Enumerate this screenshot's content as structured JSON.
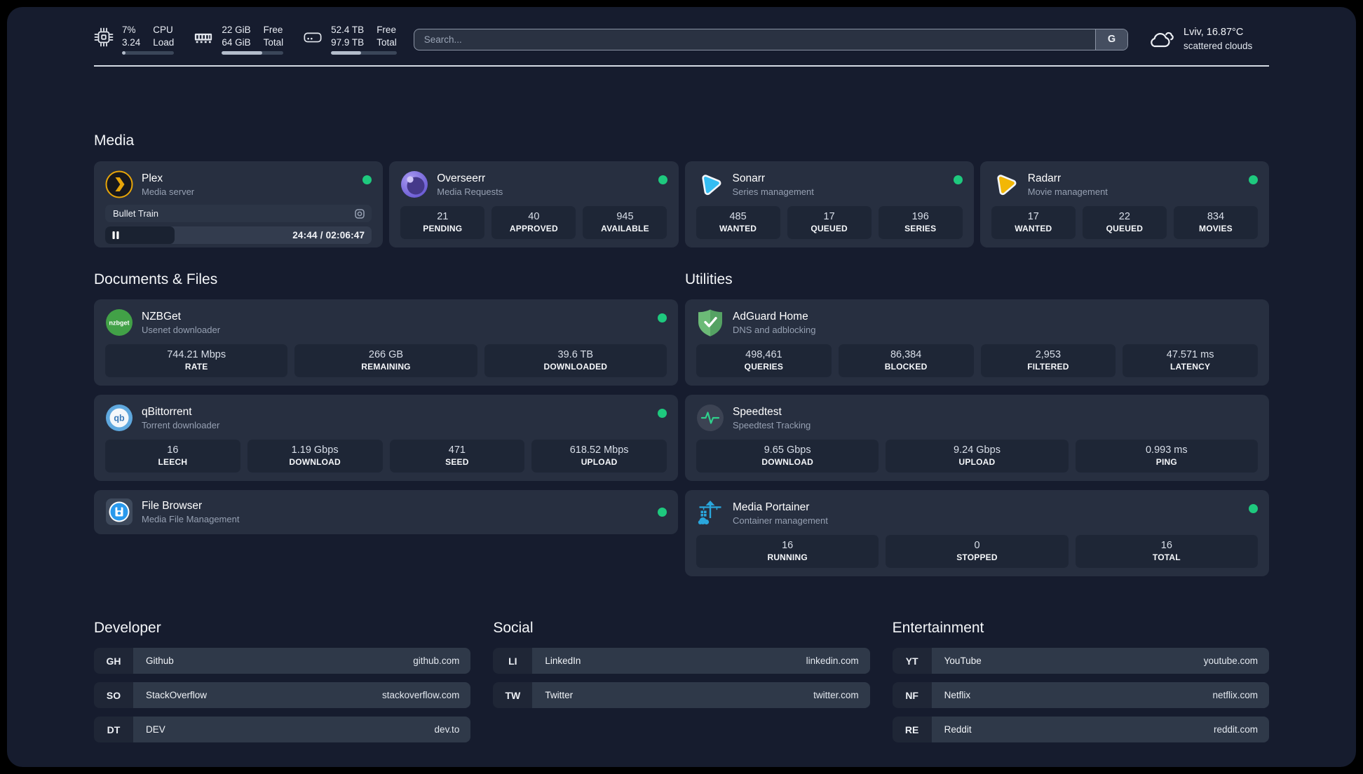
{
  "topbar": {
    "stats": [
      {
        "icon": "cpu-icon",
        "v1": "7%",
        "v2": "3.24",
        "l1": "CPU",
        "l2": "Load",
        "pct": 7
      },
      {
        "icon": "ram-icon",
        "v1": "22 GiB",
        "v2": "64 GiB",
        "l1": "Free",
        "l2": "Total",
        "pct": 66
      },
      {
        "icon": "disk-icon",
        "v1": "52.4 TB",
        "v2": "97.9 TB",
        "l1": "Free",
        "l2": "Total",
        "pct": 46
      }
    ],
    "search": {
      "placeholder": "Search...",
      "provider": "G"
    },
    "weather": {
      "line1": "Lviv, 16.87°C",
      "line2": "scattered clouds"
    }
  },
  "media": {
    "heading": "Media",
    "plex": {
      "title": "Plex",
      "subtitle": "Media server",
      "now_playing": "Bullet Train",
      "time": "24:44 / 02:06:47",
      "progress_pct": 26
    },
    "overseerr": {
      "title": "Overseerr",
      "subtitle": "Media Requests",
      "stats": [
        {
          "value": "21",
          "label": "PENDING"
        },
        {
          "value": "40",
          "label": "APPROVED"
        },
        {
          "value": "945",
          "label": "AVAILABLE"
        }
      ]
    },
    "sonarr": {
      "title": "Sonarr",
      "subtitle": "Series management",
      "stats": [
        {
          "value": "485",
          "label": "WANTED"
        },
        {
          "value": "17",
          "label": "QUEUED"
        },
        {
          "value": "196",
          "label": "SERIES"
        }
      ]
    },
    "radarr": {
      "title": "Radarr",
      "subtitle": "Movie management",
      "stats": [
        {
          "value": "17",
          "label": "WANTED"
        },
        {
          "value": "22",
          "label": "QUEUED"
        },
        {
          "value": "834",
          "label": "MOVIES"
        }
      ]
    }
  },
  "documents": {
    "heading": "Documents & Files",
    "nzbget": {
      "title": "NZBGet",
      "subtitle": "Usenet downloader",
      "stats": [
        {
          "value": "744.21 Mbps",
          "label": "RATE"
        },
        {
          "value": "266 GB",
          "label": "REMAINING"
        },
        {
          "value": "39.6 TB",
          "label": "DOWNLOADED"
        }
      ]
    },
    "qbittorrent": {
      "title": "qBittorrent",
      "subtitle": "Torrent downloader",
      "stats": [
        {
          "value": "16",
          "label": "LEECH"
        },
        {
          "value": "1.19 Gbps",
          "label": "DOWNLOAD"
        },
        {
          "value": "471",
          "label": "SEED"
        },
        {
          "value": "618.52 Mbps",
          "label": "UPLOAD"
        }
      ]
    },
    "filebrowser": {
      "title": "File Browser",
      "subtitle": "Media File Management"
    }
  },
  "utilities": {
    "heading": "Utilities",
    "adguard": {
      "title": "AdGuard Home",
      "subtitle": "DNS and adblocking",
      "stats": [
        {
          "value": "498,461",
          "label": "QUERIES"
        },
        {
          "value": "86,384",
          "label": "BLOCKED"
        },
        {
          "value": "2,953",
          "label": "FILTERED"
        },
        {
          "value": "47.571 ms",
          "label": "LATENCY"
        }
      ]
    },
    "speedtest": {
      "title": "Speedtest",
      "subtitle": "Speedtest Tracking",
      "stats": [
        {
          "value": "9.65 Gbps",
          "label": "DOWNLOAD"
        },
        {
          "value": "9.24 Gbps",
          "label": "UPLOAD"
        },
        {
          "value": "0.993 ms",
          "label": "PING"
        }
      ]
    },
    "portainer": {
      "title": "Media Portainer",
      "subtitle": "Container management",
      "stats": [
        {
          "value": "16",
          "label": "RUNNING"
        },
        {
          "value": "0",
          "label": "STOPPED"
        },
        {
          "value": "16",
          "label": "TOTAL"
        }
      ]
    }
  },
  "links": {
    "developer": {
      "heading": "Developer",
      "items": [
        {
          "abbr": "GH",
          "name": "Github",
          "url": "github.com"
        },
        {
          "abbr": "SO",
          "name": "StackOverflow",
          "url": "stackoverflow.com"
        },
        {
          "abbr": "DT",
          "name": "DEV",
          "url": "dev.to"
        }
      ]
    },
    "social": {
      "heading": "Social",
      "items": [
        {
          "abbr": "LI",
          "name": "LinkedIn",
          "url": "linkedin.com"
        },
        {
          "abbr": "TW",
          "name": "Twitter",
          "url": "twitter.com"
        }
      ]
    },
    "entertainment": {
      "heading": "Entertainment",
      "items": [
        {
          "abbr": "YT",
          "name": "YouTube",
          "url": "youtube.com"
        },
        {
          "abbr": "NF",
          "name": "Netflix",
          "url": "netflix.com"
        },
        {
          "abbr": "RE",
          "name": "Reddit",
          "url": "reddit.com"
        }
      ]
    }
  },
  "colors": {
    "status_online": "#1ec97e",
    "plex_accent": "#e7a509"
  }
}
